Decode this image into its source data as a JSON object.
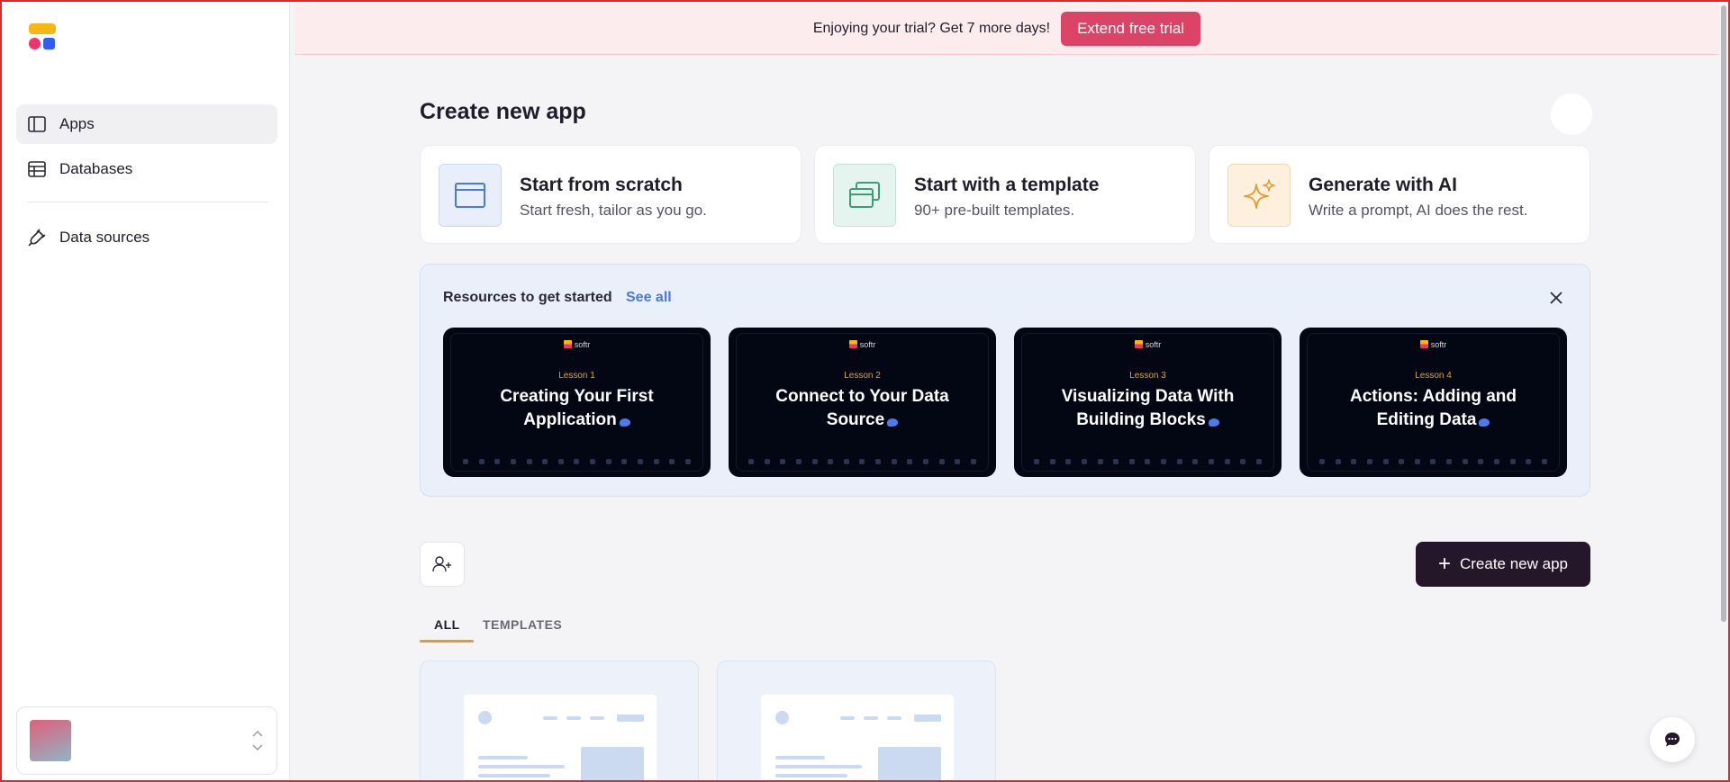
{
  "sidebar": {
    "items": [
      {
        "label": "Apps",
        "icon": "sidebar-layout-icon"
      },
      {
        "label": "Databases",
        "icon": "table-icon"
      },
      {
        "label": "Data sources",
        "icon": "plug-icon"
      }
    ],
    "workspace": {
      "name": ""
    }
  },
  "banner": {
    "text": "Enjoying your trial? Get 7 more days!",
    "button": "Extend free trial"
  },
  "main": {
    "title": "Create new app",
    "create_options": [
      {
        "title": "Start from scratch",
        "subtitle": "Start fresh, tailor as you go.",
        "icon": "browser-window-icon",
        "color": "#e8effb"
      },
      {
        "title": "Start with a template",
        "subtitle": "90+ pre-built templates.",
        "icon": "stacked-windows-icon",
        "color": "#e6f4ef"
      },
      {
        "title": "Generate with AI",
        "subtitle": "Write a prompt, AI does the rest.",
        "icon": "sparkle-icon",
        "color": "#fdf0dd"
      }
    ],
    "resources": {
      "title": "Resources to get started",
      "see_all": "See all",
      "lessons": [
        {
          "brand": "softr",
          "number": "Lesson 1",
          "title": "Creating Your First Application"
        },
        {
          "brand": "softr",
          "number": "Lesson 2",
          "title": "Connect to Your Data Source"
        },
        {
          "brand": "softr",
          "number": "Lesson 3",
          "title": "Visualizing Data With Building Blocks"
        },
        {
          "brand": "softr",
          "number": "Lesson 4",
          "title": "Actions: Adding and Editing Data"
        }
      ]
    },
    "create_button": "Create new app",
    "tabs": [
      "ALL",
      "TEMPLATES"
    ]
  },
  "colors": {
    "accent": "#dc4467",
    "primary_button": "#241729",
    "tab_underline": "#e49a2e",
    "link": "#4a7ad6"
  }
}
